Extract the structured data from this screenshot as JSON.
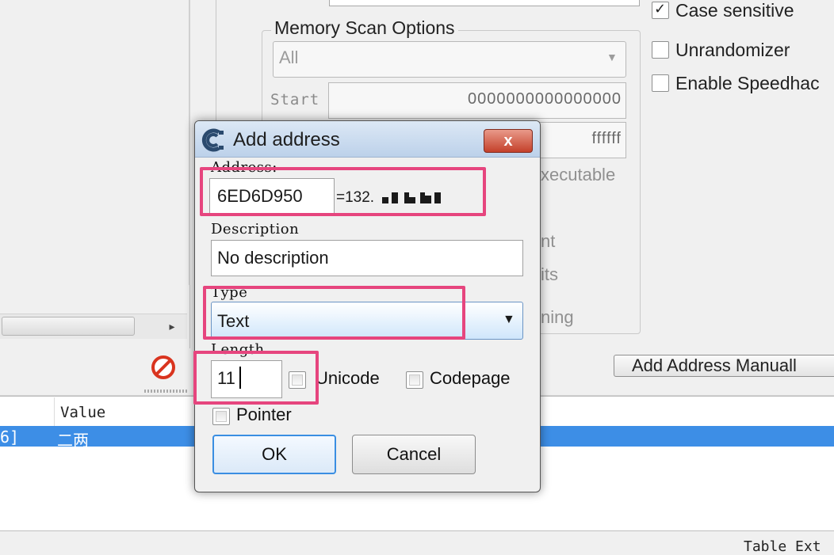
{
  "main": {
    "memory_scan_options": {
      "title": "Memory Scan Options",
      "region_select": "All",
      "start_label": "Start",
      "start_value": "0000000000000000",
      "stop_value": "ffffff",
      "executable_label": "xecutable",
      "hidden_label_1": "nt",
      "hidden_label_2": "its",
      "hidden_label_3": "ning"
    },
    "options": {
      "case_sensitive": "Case sensitive",
      "unrandomizer": "Unrandomizer",
      "enable_speedhack": "Enable Speedhac"
    },
    "add_address_manually": "Add Address Manuall",
    "address_list": {
      "header_value": "Value",
      "row_address": "6]",
      "row_value": "二两"
    },
    "table_extras": "Table Ext"
  },
  "dialog": {
    "title": "Add address",
    "close_symbol": "x",
    "address_label": "Address:",
    "address_value": "6ED6D950",
    "address_result": "=132.",
    "description_label": "Description",
    "description_value": "No description",
    "type_label": "Type",
    "type_value": "Text",
    "length_label": "Length",
    "length_value": "11",
    "unicode_label": "Unicode",
    "codepage_label": "Codepage",
    "pointer_label": "Pointer",
    "ok_label": "OK",
    "cancel_label": "Cancel"
  },
  "colors": {
    "highlight": "#e6457e",
    "selected_row": "#3d8ee6",
    "close_button": "#c4402a"
  }
}
